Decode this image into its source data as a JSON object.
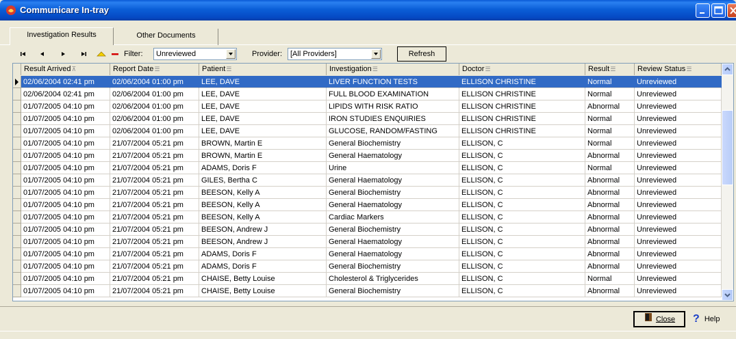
{
  "window": {
    "title": "Communicare In-tray"
  },
  "tabs": [
    {
      "label": "Investigation Results",
      "active": true
    },
    {
      "label": "Other Documents",
      "active": false
    }
  ],
  "toolbar": {
    "filter_label": "Filter:",
    "filter_value": "Unreviewed",
    "provider_label": "Provider:",
    "provider_value": "[All Providers]",
    "refresh_label": "Refresh"
  },
  "grid": {
    "columns": [
      "Result Arrived",
      "Report Date",
      "Patient",
      "Investigation",
      "Doctor",
      "Result",
      "Review Status"
    ],
    "rows": [
      [
        "02/06/2004 02:41 pm",
        "02/06/2004 01:00 pm",
        "LEE, DAVE",
        "LIVER FUNCTION TESTS",
        "ELLISON CHRISTINE",
        "Normal",
        "Unreviewed"
      ],
      [
        "02/06/2004 02:41 pm",
        "02/06/2004 01:00 pm",
        "LEE, DAVE",
        "FULL BLOOD EXAMINATION",
        "ELLISON CHRISTINE",
        "Normal",
        "Unreviewed"
      ],
      [
        "01/07/2005 04:10 pm",
        "02/06/2004 01:00 pm",
        "LEE, DAVE",
        "LIPIDS WITH RISK RATIO",
        "ELLISON CHRISTINE",
        "Abnormal",
        "Unreviewed"
      ],
      [
        "01/07/2005 04:10 pm",
        "02/06/2004 01:00 pm",
        "LEE, DAVE",
        "IRON STUDIES ENQUIRIES",
        "ELLISON CHRISTINE",
        "Normal",
        "Unreviewed"
      ],
      [
        "01/07/2005 04:10 pm",
        "02/06/2004 01:00 pm",
        "LEE, DAVE",
        "GLUCOSE, RANDOM/FASTING",
        "ELLISON CHRISTINE",
        "Normal",
        "Unreviewed"
      ],
      [
        "01/07/2005 04:10 pm",
        "21/07/2004 05:21 pm",
        "BROWN, Martin E",
        "General Biochemistry",
        "ELLISON, C",
        "Normal",
        "Unreviewed"
      ],
      [
        "01/07/2005 04:10 pm",
        "21/07/2004 05:21 pm",
        "BROWN, Martin E",
        "General Haematology",
        "ELLISON, C",
        "Abnormal",
        "Unreviewed"
      ],
      [
        "01/07/2005 04:10 pm",
        "21/07/2004 05:21 pm",
        "ADAMS, Doris F",
        "Urine",
        "ELLISON, C",
        "Normal",
        "Unreviewed"
      ],
      [
        "01/07/2005 04:10 pm",
        "21/07/2004 05:21 pm",
        "GILES, Bertha C",
        "General Haematology",
        "ELLISON, C",
        "Abnormal",
        "Unreviewed"
      ],
      [
        "01/07/2005 04:10 pm",
        "21/07/2004 05:21 pm",
        "BEESON, Kelly A",
        "General Biochemistry",
        "ELLISON, C",
        "Abnormal",
        "Unreviewed"
      ],
      [
        "01/07/2005 04:10 pm",
        "21/07/2004 05:21 pm",
        "BEESON, Kelly A",
        "General Haematology",
        "ELLISON, C",
        "Abnormal",
        "Unreviewed"
      ],
      [
        "01/07/2005 04:10 pm",
        "21/07/2004 05:21 pm",
        "BEESON, Kelly A",
        "Cardiac Markers",
        "ELLISON, C",
        "Abnormal",
        "Unreviewed"
      ],
      [
        "01/07/2005 04:10 pm",
        "21/07/2004 05:21 pm",
        "BEESON, Andrew J",
        "General Biochemistry",
        "ELLISON, C",
        "Abnormal",
        "Unreviewed"
      ],
      [
        "01/07/2005 04:10 pm",
        "21/07/2004 05:21 pm",
        "BEESON, Andrew J",
        "General Haematology",
        "ELLISON, C",
        "Abnormal",
        "Unreviewed"
      ],
      [
        "01/07/2005 04:10 pm",
        "21/07/2004 05:21 pm",
        "ADAMS, Doris F",
        "General Haematology",
        "ELLISON, C",
        "Abnormal",
        "Unreviewed"
      ],
      [
        "01/07/2005 04:10 pm",
        "21/07/2004 05:21 pm",
        "ADAMS, Doris F",
        "General Biochemistry",
        "ELLISON, C",
        "Abnormal",
        "Unreviewed"
      ],
      [
        "01/07/2005 04:10 pm",
        "21/07/2004 05:21 pm",
        "CHAISE, Betty Louise",
        "Cholesterol & Triglycerides",
        "ELLISON, C",
        "Normal",
        "Unreviewed"
      ],
      [
        "01/07/2005 04:10 pm",
        "21/07/2004 05:21 pm",
        "CHAISE, Betty Louise",
        "General Biochemistry",
        "ELLISON, C",
        "Abnormal",
        "Unreviewed"
      ]
    ]
  },
  "footer": {
    "close_label": "Close",
    "help_label": "Help"
  },
  "colors": {
    "selection": "#316ac5",
    "titlebar": "#0b5fd8",
    "window_bg": "#ece9d8"
  }
}
